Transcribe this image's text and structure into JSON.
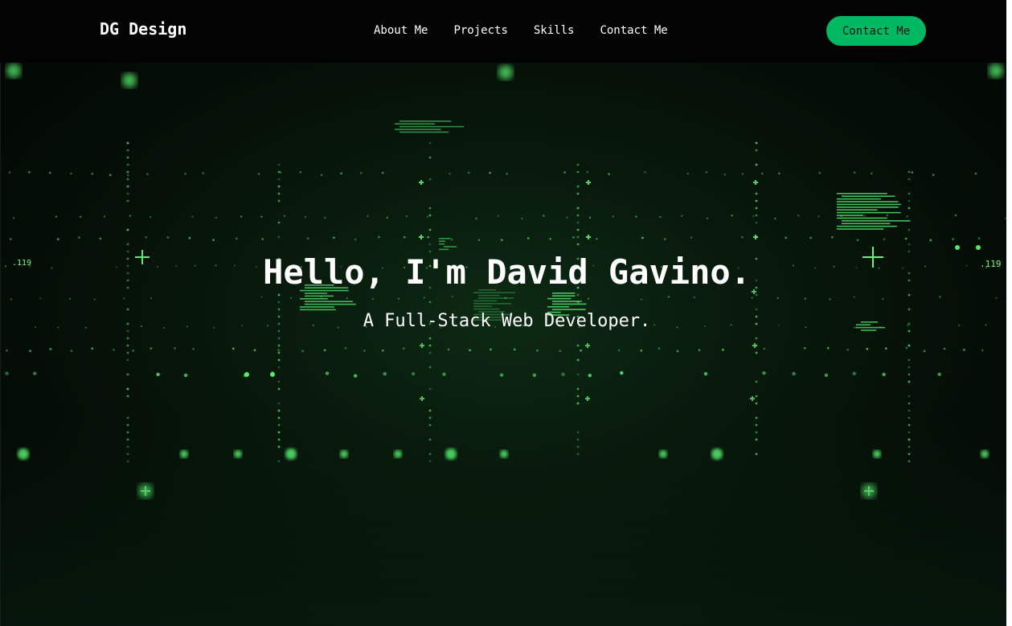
{
  "brand": {
    "name": "DG Design"
  },
  "nav": {
    "links": [
      {
        "label": "About Me"
      },
      {
        "label": "Projects"
      },
      {
        "label": "Skills"
      },
      {
        "label": "Contact Me"
      }
    ],
    "cta_label": "Contact Me"
  },
  "hero": {
    "title": "Hello, I'm David Gavino.",
    "subtitle": "A Full-Stack Web Developer.",
    "background_label_left": ".119",
    "background_label_right": ".119"
  },
  "colors": {
    "navbar": "#030303",
    "accent": "#00b862",
    "matrix_green": "#39ff5a",
    "hero_bg": "#08190c"
  }
}
